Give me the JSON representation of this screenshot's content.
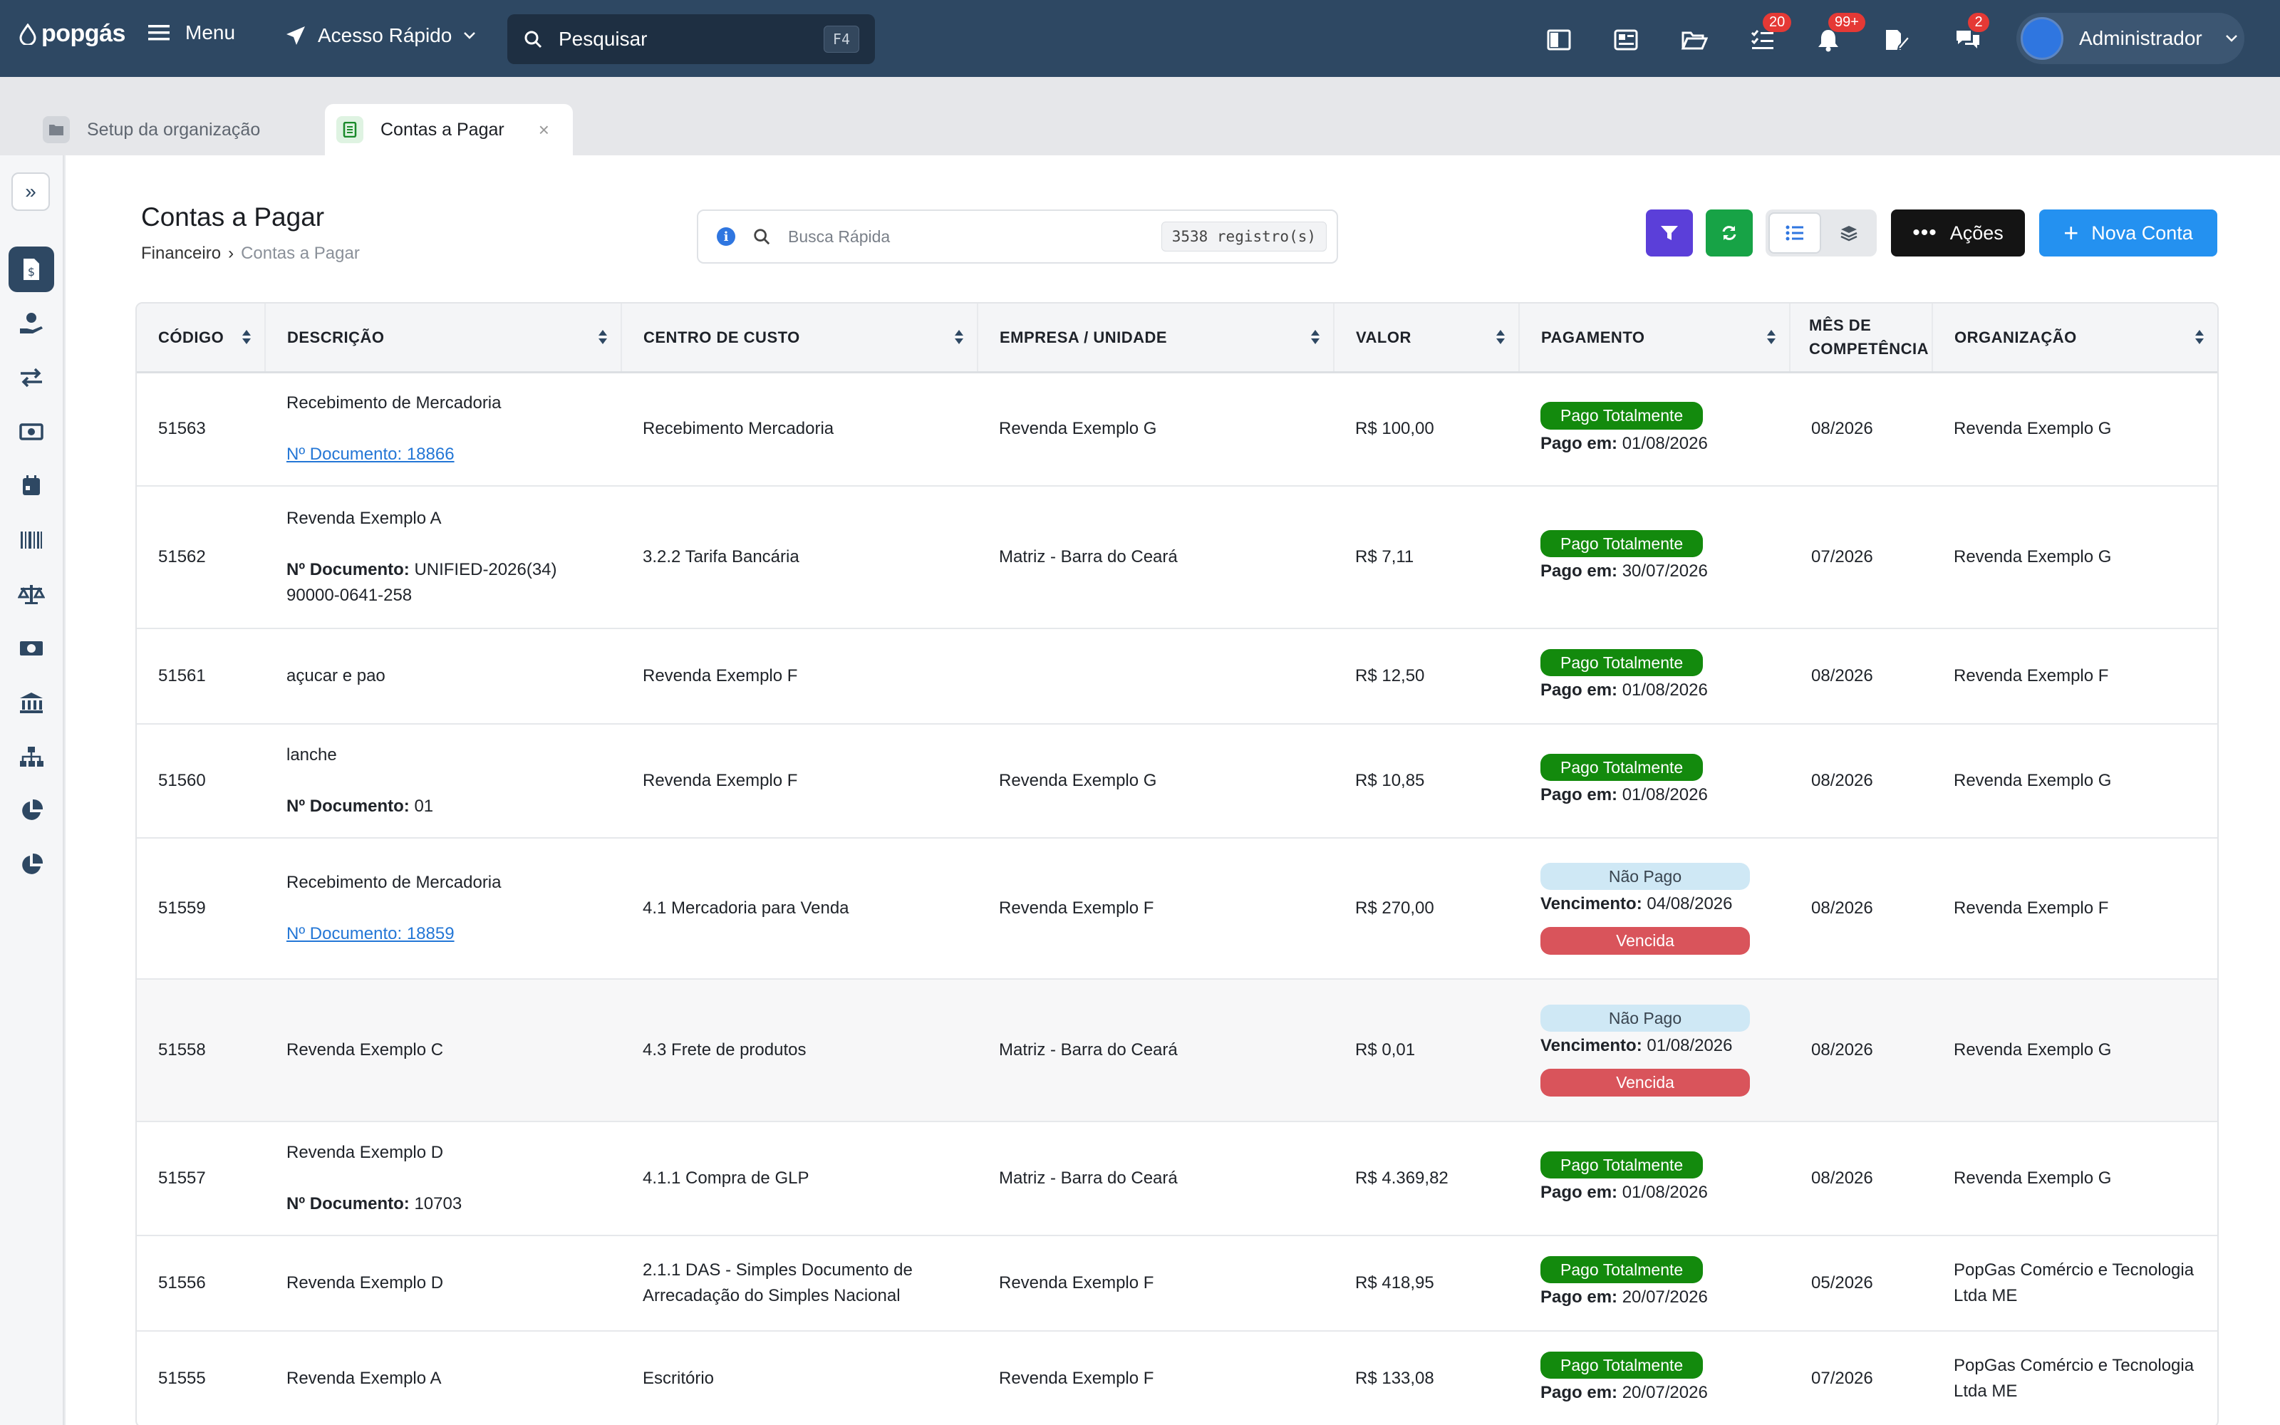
{
  "topbar": {
    "logo_text": "popgás",
    "menu_label": "Menu",
    "quick_access_label": "Acesso Rápido",
    "search_placeholder": "Pesquisar",
    "search_shortcut": "F4",
    "badges": {
      "tasks": "20",
      "notifications": "99+",
      "messages": "2"
    },
    "user_name": "Administrador",
    "colors": {
      "bar": "#2e4863",
      "badge": "#e53935"
    }
  },
  "tabs": [
    {
      "label": "Setup da organização",
      "active": false
    },
    {
      "label": "Contas a Pagar",
      "active": true
    }
  ],
  "page": {
    "title": "Contas a Pagar",
    "breadcrumb": [
      "Financeiro",
      "Contas a Pagar"
    ],
    "quick_search_placeholder": "Busca Rápida",
    "records_count": "3538 registro(s)",
    "actions_label": "Ações",
    "new_label": "Nova Conta"
  },
  "table": {
    "headers": [
      "CÓDIGO",
      "DESCRIÇÃO",
      "CENTRO DE CUSTO",
      "EMPRESA / UNIDADE",
      "VALOR",
      "PAGAMENTO",
      "MÊS DE COMPETÊNCIA",
      "ORGANIZAÇÃO"
    ],
    "doc_label": "Nº Documento:",
    "rows": [
      {
        "code": "51563",
        "desc": "Recebimento de Mercadoria",
        "doc": "Nº Documento: 18866",
        "doc_style": "link",
        "cost": "Recebimento Mercadoria",
        "company": "Revenda Exemplo G",
        "value": "R$ 100,00",
        "status": "Pago Totalmente",
        "date_label": "Pago em:",
        "date": "01/08/2026",
        "overdue": "",
        "month": "08/2026",
        "org": "Revenda Exemplo G"
      },
      {
        "code": "51562",
        "desc": "Revenda Exemplo A",
        "doc": "UNIFIED-2026(34) 90000-0641-258",
        "doc_style": "bold",
        "cost": "3.2.2 Tarifa Bancária",
        "company": "Matriz - Barra do Ceará",
        "value": "R$ 7,11",
        "status": "Pago Totalmente",
        "date_label": "Pago em:",
        "date": "30/07/2026",
        "overdue": "",
        "month": "07/2026",
        "org": "Revenda Exemplo G"
      },
      {
        "code": "51561",
        "desc": "açucar e pao",
        "doc": "",
        "doc_style": "none",
        "cost": "Revenda Exemplo F",
        "company": "",
        "value": "R$ 12,50",
        "status": "Pago Totalmente",
        "date_label": "Pago em:",
        "date": "01/08/2026",
        "overdue": "",
        "month": "08/2026",
        "org": "Revenda Exemplo F"
      },
      {
        "code": "51560",
        "desc": "lanche",
        "doc": "01",
        "doc_style": "bold",
        "cost": "Revenda Exemplo F",
        "company": "Revenda Exemplo G",
        "value": "R$ 10,85",
        "status": "Pago Totalmente",
        "date_label": "Pago em:",
        "date": "01/08/2026",
        "overdue": "",
        "month": "08/2026",
        "org": "Revenda Exemplo G"
      },
      {
        "code": "51559",
        "desc": "Recebimento de Mercadoria",
        "doc": "Nº Documento: 18859",
        "doc_style": "link",
        "cost": "4.1 Mercadoria para Venda",
        "company": "Revenda Exemplo F",
        "value": "R$ 270,00",
        "status": "Não Pago",
        "date_label": "Vencimento:",
        "date": "04/08/2026",
        "overdue": "Vencida",
        "month": "08/2026",
        "org": "Revenda Exemplo F"
      },
      {
        "code": "51558",
        "desc": "Revenda Exemplo C",
        "doc": "",
        "doc_style": "none",
        "cost": "4.3 Frete de produtos",
        "company": "Matriz - Barra do Ceará",
        "value": "R$ 0,01",
        "status": "Não Pago",
        "date_label": "Vencimento:",
        "date": "01/08/2026",
        "overdue": "Vencida",
        "month": "08/2026",
        "org": "Revenda Exemplo G"
      },
      {
        "code": "51557",
        "desc": "Revenda Exemplo D",
        "doc": "10703",
        "doc_style": "bold",
        "cost": "4.1.1 Compra de GLP",
        "company": "Matriz - Barra do Ceará",
        "value": "R$ 4.369,82",
        "status": "Pago Totalmente",
        "date_label": "Pago em:",
        "date": "01/08/2026",
        "overdue": "",
        "month": "08/2026",
        "org": "Revenda Exemplo G"
      },
      {
        "code": "51556",
        "desc": "Revenda Exemplo D",
        "doc": "",
        "doc_style": "none",
        "cost": "2.1.1 DAS - Simples Documento de Arrecadação do Simples Nacional",
        "company": "Revenda Exemplo F",
        "value": "R$ 418,95",
        "status": "Pago Totalmente",
        "date_label": "Pago em:",
        "date": "20/07/2026",
        "overdue": "",
        "month": "05/2026",
        "org": "PopGas Comércio e Tecnologia Ltda ME"
      },
      {
        "code": "51555",
        "desc": "Revenda Exemplo A",
        "doc": "",
        "doc_style": "none",
        "cost": "Escritório",
        "company": "Revenda Exemplo F",
        "value": "R$ 133,08",
        "status": "Pago Totalmente",
        "date_label": "Pago em:",
        "date": "20/07/2026",
        "overdue": "",
        "month": "07/2026",
        "org": "PopGas Comércio e Tecnologia Ltda ME"
      }
    ]
  }
}
